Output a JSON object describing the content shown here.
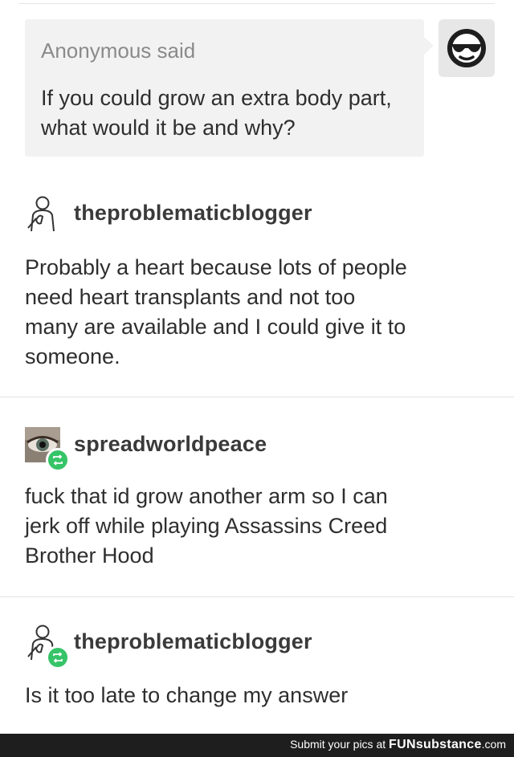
{
  "ask": {
    "asker_name": "Anonymous",
    "asker_suffix": "said",
    "question": "If you could grow an extra body part, what would it be and why?",
    "asker_avatar_icon": "sunglasses-face-icon"
  },
  "posts": [
    {
      "username": "theproblematicblogger",
      "avatar_icon": "thinking-person-icon",
      "reblog": false,
      "text": "Probably a heart because lots of people\nneed heart transplants and not too\nmany are available and I could give it to\nsomeone."
    },
    {
      "username": "spreadworldpeace",
      "avatar_icon": "eye-photo-avatar",
      "reblog": true,
      "text": "fuck that id grow another arm so I can\njerk off while playing Assassins Creed\nBrother Hood"
    },
    {
      "username": "theproblematicblogger",
      "avatar_icon": "thinking-person-icon",
      "reblog": true,
      "text": "Is it too late to change my answer"
    }
  ],
  "footer": {
    "prefix": "Submit your pics at",
    "brand": "FUNsubstance",
    "suffix": ".com"
  },
  "colors": {
    "reblog_badge": "#36c468",
    "bubble": "#f2f2f2",
    "footer_bg": "#1e1e1e"
  }
}
